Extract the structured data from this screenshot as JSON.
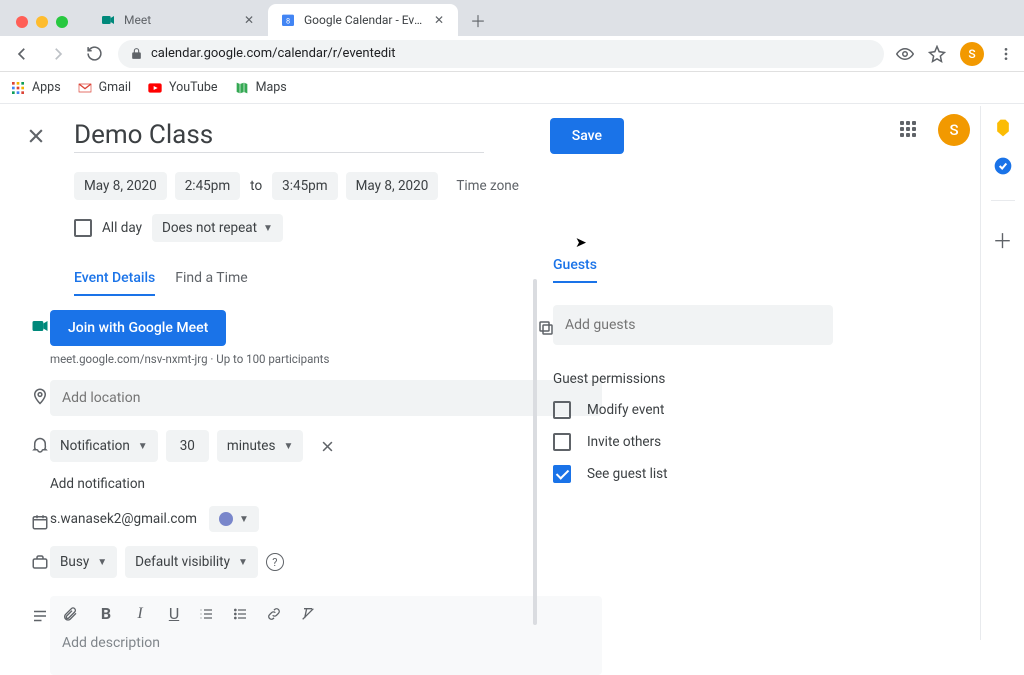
{
  "browser": {
    "tabs": [
      {
        "title": "Meet",
        "active": false
      },
      {
        "title": "Google Calendar - Event detail",
        "active": true
      }
    ],
    "url": "calendar.google.com/calendar/r/eventedit",
    "bookmarks": [
      {
        "label": "Apps"
      },
      {
        "label": "Gmail"
      },
      {
        "label": "YouTube"
      },
      {
        "label": "Maps"
      }
    ],
    "avatar_letter": "S"
  },
  "event": {
    "title": "Demo Class",
    "start_date": "May 8, 2020",
    "start_time": "2:45pm",
    "to": "to",
    "end_time": "3:45pm",
    "end_date": "May 8, 2020",
    "timezone_label": "Time zone",
    "all_day_label": "All day",
    "repeat": "Does not repeat",
    "save_label": "Save"
  },
  "subtabs": {
    "details": "Event Details",
    "findtime": "Find a Time"
  },
  "meet": {
    "button": "Join with Google Meet",
    "link": "meet.google.com/nsv-nxmt-jrg",
    "separator": " · ",
    "participants": "Up to 100 participants"
  },
  "location": {
    "placeholder": "Add location"
  },
  "notification": {
    "type": "Notification",
    "value": "30",
    "unit": "minutes",
    "add_label": "Add notification"
  },
  "calendar": {
    "email": "s.wanasek2@gmail.com"
  },
  "visibility": {
    "busy": "Busy",
    "default": "Default visibility"
  },
  "description": {
    "placeholder": "Add description"
  },
  "guests": {
    "tab_label": "Guests",
    "add_placeholder": "Add guests",
    "permissions_title": "Guest permissions",
    "perm_modify": "Modify event",
    "perm_invite": "Invite others",
    "perm_seelist": "See guest list"
  }
}
